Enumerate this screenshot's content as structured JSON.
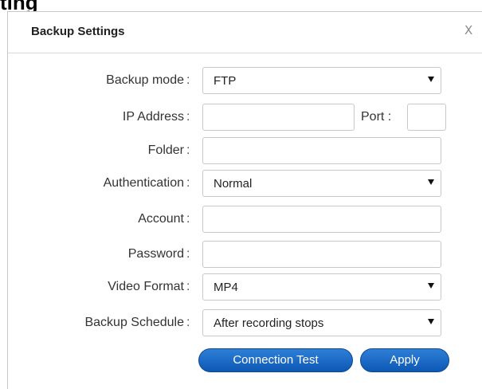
{
  "background": {
    "title": "ting"
  },
  "dialog": {
    "title": "Backup Settings",
    "close_label": "X"
  },
  "form": {
    "backup_mode": {
      "label": "Backup mode",
      "colon": ":",
      "value": "FTP"
    },
    "ip_address": {
      "label": "IP Address",
      "colon": ":",
      "value": ""
    },
    "port": {
      "label": "Port :",
      "value": ""
    },
    "folder": {
      "label": "Folder",
      "colon": ":",
      "value": ""
    },
    "authentication": {
      "label": "Authentication",
      "colon": ":",
      "value": "Normal"
    },
    "account": {
      "label": "Account",
      "colon": ":",
      "value": ""
    },
    "password": {
      "label": "Password",
      "colon": ":",
      "value": ""
    },
    "video_format": {
      "label": "Video Format",
      "colon": ":",
      "value": "MP4"
    },
    "backup_schedule": {
      "label": "Backup Schedule",
      "colon": ":",
      "value": "After recording stops"
    }
  },
  "buttons": {
    "connection_test": "Connection Test",
    "apply": "Apply"
  },
  "colors": {
    "button_blue": "#1a66c2",
    "border_gray": "#c9c9c9"
  }
}
